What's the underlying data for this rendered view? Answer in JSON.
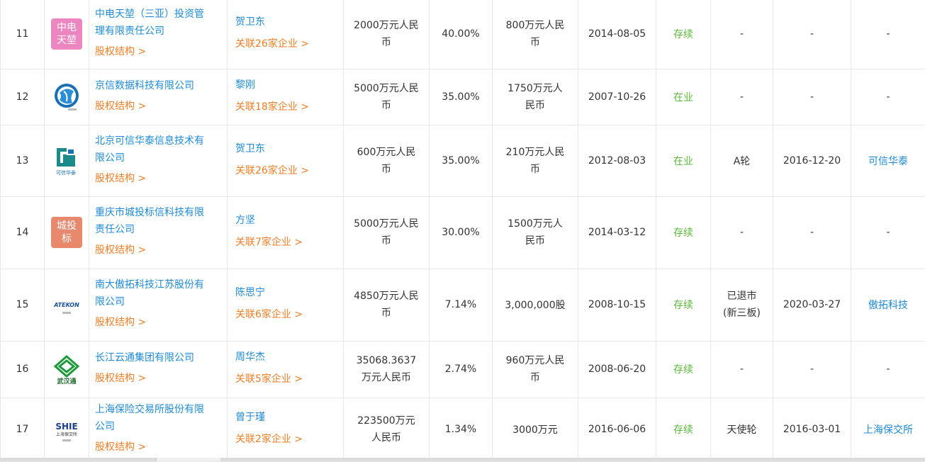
{
  "rows": [
    {
      "no": "11",
      "logo": {
        "type": "text",
        "text_l1": "中电",
        "text_l2": "天堃",
        "bg": "#ec86c0"
      },
      "company": "中电天堃（三亚）投资管理有限责任公司",
      "company_l1": "中电天堃（三亚）投资管",
      "company_l2": "理有限责任公司",
      "equity_link": "股权结构 >",
      "person": "贺卫东",
      "related": "关联26家企业 >",
      "capital_l1": "2000万元人民",
      "capital_l2": "币",
      "ratio": "40.00%",
      "amount_l1": "800万元人民",
      "amount_l2": "币",
      "date": "2014-08-05",
      "status": "存续",
      "round": "-",
      "fin_date": "-",
      "product": "-"
    },
    {
      "no": "12",
      "logo": {
        "type": "icon",
        "icon": "globe-logo-icon"
      },
      "company": "京信数据科技有限公司",
      "equity_link": "股权结构 >",
      "person": "黎刚",
      "related": "关联18家企业 >",
      "capital_l1": "5000万元人民",
      "capital_l2": "币",
      "ratio": "35.00%",
      "amount_l1": "1750万元人",
      "amount_l2": "民币",
      "date": "2007-10-26",
      "status": "在业",
      "round": "-",
      "fin_date": "-",
      "product": "-"
    },
    {
      "no": "13",
      "logo": {
        "type": "icon",
        "icon": "kexin-logo-icon",
        "caption": "可信华泰"
      },
      "company": "北京可信华泰信息技术有限公司",
      "company_l1": "北京可信华泰信息技术有",
      "company_l2": "限公司",
      "equity_link": "股权结构 >",
      "person": "贺卫东",
      "related": "关联26家企业 >",
      "capital_l1": "600万元人民",
      "capital_l2": "币",
      "ratio": "35.00%",
      "amount_l1": "210万元人民",
      "amount_l2": "币",
      "date": "2012-08-03",
      "status": "在业",
      "round": "A轮",
      "fin_date": "2016-12-20",
      "product": "可信华泰"
    },
    {
      "no": "14",
      "logo": {
        "type": "text",
        "text_l1": "城投",
        "text_l2": "标",
        "bg": "#e8896e"
      },
      "company": "重庆市城投标信科技有限责任公司",
      "company_l1": "重庆市城投标信科技有限",
      "company_l2": "责任公司",
      "equity_link": "股权结构 >",
      "person": "方坚",
      "related": "关联7家企业 >",
      "capital_l1": "5000万元人民",
      "capital_l2": "币",
      "ratio": "30.00%",
      "amount_l1": "1500万元人",
      "amount_l2": "民币",
      "date": "2014-03-12",
      "status": "存续",
      "round": "-",
      "fin_date": "-",
      "product": "-"
    },
    {
      "no": "15",
      "logo": {
        "type": "icon",
        "icon": "atekon-logo-icon",
        "wordmark": "ATEKON"
      },
      "company": "南大傲拓科技江苏股份有限公司",
      "company_l1": "南大傲拓科技江苏股份有",
      "company_l2": "限公司",
      "equity_link": "股权结构 >",
      "person": "陈思宁",
      "related": "关联6家企业 >",
      "capital_l1": "4850万元人民",
      "capital_l2": "币",
      "ratio": "7.14%",
      "amount": "3,000,000股",
      "date": "2008-10-15",
      "status": "存续",
      "round_l1": "已退市",
      "round_l2": "(新三板)",
      "fin_date": "2020-03-27",
      "product": "傲拓科技"
    },
    {
      "no": "16",
      "logo": {
        "type": "icon",
        "icon": "wuhan-logo-icon",
        "caption": "武汉通"
      },
      "company": "长江云通集团有限公司",
      "equity_link": "股权结构 >",
      "person": "周华杰",
      "related": "关联5家企业 >",
      "capital_l1": "35068.3637",
      "capital_l2": "万元人民币",
      "ratio": "2.74%",
      "amount_l1": "960万元人民",
      "amount_l2": "币",
      "date": "2008-06-20",
      "status": "存续",
      "round": "-",
      "fin_date": "-",
      "product": "-"
    },
    {
      "no": "17",
      "logo": {
        "type": "icon",
        "icon": "shie-logo-icon",
        "wordmark": "SHIE",
        "caption": "上海保交所"
      },
      "company": "上海保险交易所股份有限公司",
      "company_l1": "上海保险交易所股份有限",
      "company_l2": "公司",
      "equity_link": "股权结构 >",
      "person": "曾于瑾",
      "related": "关联2家企业 >",
      "capital_l1": "223500万元",
      "capital_l2": "人民币",
      "ratio": "1.34%",
      "amount": "3000万元",
      "date": "2016-06-06",
      "status": "存续",
      "round": "天使轮",
      "fin_date": "2016-03-01",
      "product": "上海保交所"
    }
  ],
  "colors": {
    "link": "#1f8bd6",
    "orange": "#f07f28",
    "status_green": "#5bb83a",
    "border": "#e8e8e8"
  }
}
